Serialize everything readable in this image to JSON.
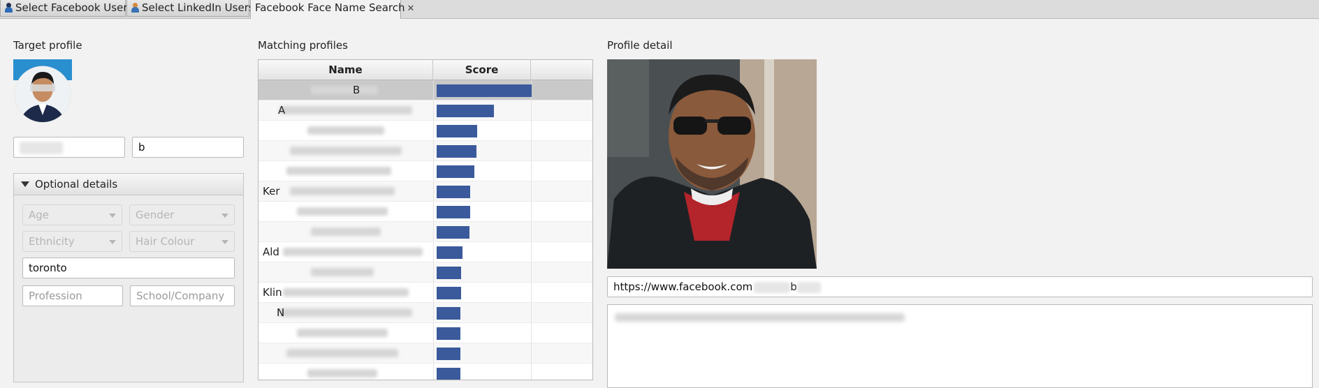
{
  "tabs": [
    {
      "label": "Select Facebook Users",
      "icon": "user-icon-blue"
    },
    {
      "label": "Select LinkedIn Users",
      "icon": "user-icon-orange"
    },
    {
      "label": "Facebook Face Name Search",
      "close": "✕"
    }
  ],
  "target": {
    "heading": "Target profile",
    "first_name": "",
    "last_name": "b"
  },
  "optional": {
    "heading": "Optional details",
    "age": "Age",
    "gender": "Gender",
    "ethnicity": "Ethnicity",
    "hair_colour": "Hair Colour",
    "location": "toronto",
    "profession_placeholder": "Profession",
    "school_placeholder": "School/Company"
  },
  "matching": {
    "heading": "Matching profiles",
    "columns": [
      "Name",
      "Score"
    ],
    "rows": [
      {
        "prefix": "B",
        "score": 0.93
      },
      {
        "prefix": "A",
        "score": 0.56
      },
      {
        "prefix": "",
        "score": 0.4
      },
      {
        "prefix": "",
        "score": 0.39
      },
      {
        "prefix": "",
        "score": 0.37
      },
      {
        "prefix": "Ker",
        "score": 0.33
      },
      {
        "prefix": "",
        "score": 0.33
      },
      {
        "prefix": "",
        "score": 0.32
      },
      {
        "prefix": "Ald",
        "score": 0.25
      },
      {
        "prefix": "",
        "score": 0.24
      },
      {
        "prefix": "Klin",
        "score": 0.24
      },
      {
        "prefix": "N",
        "score": 0.23
      },
      {
        "prefix": "",
        "score": 0.23
      },
      {
        "prefix": "",
        "score": 0.23
      },
      {
        "prefix": "",
        "score": 0.23
      }
    ]
  },
  "detail": {
    "heading": "Profile detail",
    "url": "https://www.facebook.com",
    "url_suffix": "b"
  },
  "colors": {
    "bar": "#3a5a9c",
    "selected_row": "#c9c9c9"
  }
}
